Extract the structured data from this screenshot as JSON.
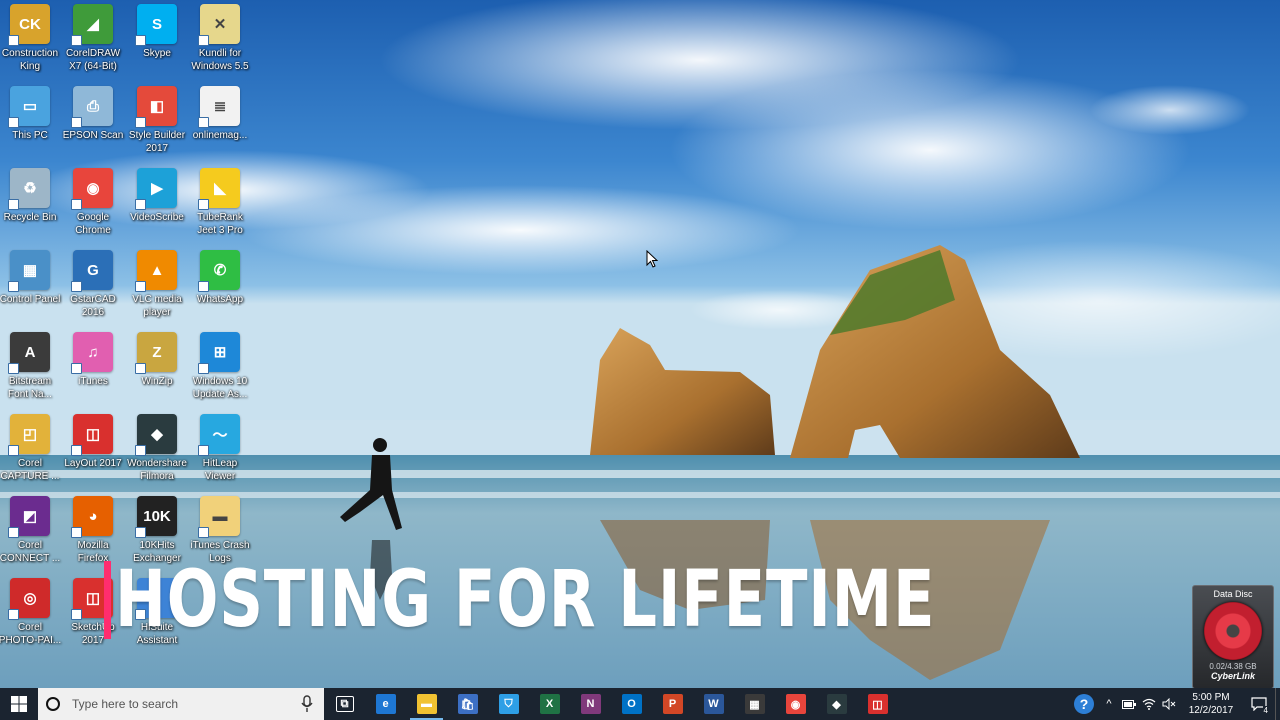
{
  "desktop": {
    "icons": [
      {
        "label": "Construction\nKing",
        "icon": "folder-person-icon",
        "color": "#d8a32c",
        "glyph": "CK"
      },
      {
        "label": "CorelDRAW\nX7 (64-Bit)",
        "icon": "coreldraw-icon",
        "color": "#3f9b3a",
        "glyph": "◢"
      },
      {
        "label": "Skype",
        "icon": "skype-icon",
        "color": "#00aff0",
        "glyph": "S"
      },
      {
        "label": "Kundli for\nWindows 5.5",
        "icon": "kundli-icon",
        "color": "#e6d78c",
        "glyph": "✕"
      },
      {
        "label": "This PC",
        "icon": "this-pc-icon",
        "color": "#4aa3df",
        "glyph": "▭"
      },
      {
        "label": "EPSON Scan",
        "icon": "epson-scan-icon",
        "color": "#8fb8d8",
        "glyph": "⎙"
      },
      {
        "label": "Style Builder\n2017",
        "icon": "style-builder-icon",
        "color": "#e44a3b",
        "glyph": "◧"
      },
      {
        "label": "onlinemag...",
        "icon": "document-icon",
        "color": "#f2f2f2",
        "glyph": "≣"
      },
      {
        "label": "Recycle Bin",
        "icon": "recycle-bin-icon",
        "color": "#9db6c8",
        "glyph": "♻"
      },
      {
        "label": "Google\nChrome",
        "icon": "chrome-icon",
        "color": "#e8453c",
        "glyph": "◉"
      },
      {
        "label": "VideoScribe",
        "icon": "videoscribe-icon",
        "color": "#1da1d8",
        "glyph": "▶"
      },
      {
        "label": "TubeRank\nJeet 3 Pro",
        "icon": "tuberank-icon",
        "color": "#f5cb1e",
        "glyph": "◣"
      },
      {
        "label": "Control Panel",
        "icon": "control-panel-icon",
        "color": "#4a90c8",
        "glyph": "▦"
      },
      {
        "label": "GstarCAD\n2016",
        "icon": "gstarcad-icon",
        "color": "#2b6fb7",
        "glyph": "G"
      },
      {
        "label": "VLC media\nplayer",
        "icon": "vlc-icon",
        "color": "#f08a00",
        "glyph": "▲"
      },
      {
        "label": "WhatsApp",
        "icon": "whatsapp-icon",
        "color": "#2fbe44",
        "glyph": "✆"
      },
      {
        "label": "Bitstream\nFont Na...",
        "icon": "bitstream-icon",
        "color": "#3b3b3b",
        "glyph": "A"
      },
      {
        "label": "iTunes",
        "icon": "itunes-icon",
        "color": "#e15fb0",
        "glyph": "♫"
      },
      {
        "label": "WinZip",
        "icon": "winzip-icon",
        "color": "#c9a640",
        "glyph": "Z"
      },
      {
        "label": "Windows 10\nUpdate As...",
        "icon": "windows-update-icon",
        "color": "#1e88d8",
        "glyph": "⊞"
      },
      {
        "label": "Corel\nCAPTURE ...",
        "icon": "corel-capture-icon",
        "color": "#e2b23a",
        "glyph": "◰"
      },
      {
        "label": "LayOut 2017",
        "icon": "layout-icon",
        "color": "#d9302e",
        "glyph": "◫"
      },
      {
        "label": "Wondershare\nFilmora",
        "icon": "filmora-icon",
        "color": "#2a3b3f",
        "glyph": "◆"
      },
      {
        "label": "HitLeap\nViewer",
        "icon": "hitleap-icon",
        "color": "#27a8e0",
        "glyph": "〜"
      },
      {
        "label": "Corel\nCONNECT ...",
        "icon": "corel-connect-icon",
        "color": "#6b2c8f",
        "glyph": "◩"
      },
      {
        "label": "Mozilla\nFirefox",
        "icon": "firefox-icon",
        "color": "#e66000",
        "glyph": "◕"
      },
      {
        "label": "10KHits\nExchanger",
        "icon": "10khits-icon",
        "color": "#222222",
        "glyph": "10K"
      },
      {
        "label": "iTunes Crash\nLogs",
        "icon": "folder-icon",
        "color": "#f1d17a",
        "glyph": "▬"
      },
      {
        "label": "Corel\nPHOTO-PAI...",
        "icon": "corel-photopaint-icon",
        "color": "#cf2a2a",
        "glyph": "◎"
      },
      {
        "label": "SketchUp\n2017",
        "icon": "sketchup-icon",
        "color": "#d9302e",
        "glyph": "◫"
      },
      {
        "label": "HiSuite\nAssistant",
        "icon": "hisuite-icon",
        "color": "#3d83d6",
        "glyph": "◐"
      }
    ]
  },
  "overlay": {
    "caption": "HOSTING FOR LIFETIME"
  },
  "widget": {
    "title": "Data Disc",
    "size": "0.02/4.38 GB",
    "brand": "CyberLink"
  },
  "taskbar": {
    "search_placeholder": "Type here to search",
    "apps": [
      {
        "name": "task-view-icon",
        "glyph": "⧉",
        "color": "transparent",
        "active": false
      },
      {
        "name": "edge-icon",
        "glyph": "e",
        "color": "#1e77d3",
        "active": false
      },
      {
        "name": "file-explorer-icon",
        "glyph": "▬",
        "color": "#f1c232",
        "active": true
      },
      {
        "name": "store-icon",
        "glyph": "🛍",
        "color": "#3c6fc4",
        "active": false
      },
      {
        "name": "security-icon",
        "glyph": "⛉",
        "color": "#2e9fe6",
        "active": false
      },
      {
        "name": "excel-icon",
        "glyph": "X",
        "color": "#1f7244",
        "active": false
      },
      {
        "name": "onenote-icon",
        "glyph": "N",
        "color": "#80397b",
        "active": false
      },
      {
        "name": "outlook-icon",
        "glyph": "O",
        "color": "#0072c6",
        "active": false
      },
      {
        "name": "powerpoint-icon",
        "glyph": "P",
        "color": "#d24726",
        "active": false
      },
      {
        "name": "word-icon",
        "glyph": "W",
        "color": "#2b579a",
        "active": false
      },
      {
        "name": "calculator-icon",
        "glyph": "▦",
        "color": "#3a3a3a",
        "active": false
      },
      {
        "name": "chrome-icon",
        "glyph": "◉",
        "color": "#e8453c",
        "active": false
      },
      {
        "name": "filmora-icon",
        "glyph": "◆",
        "color": "#2a3b3f",
        "active": false
      },
      {
        "name": "sketchup-icon",
        "glyph": "◫",
        "color": "#d9302e",
        "active": false
      }
    ],
    "tray": {
      "help_glyph": "?",
      "chevron_glyph": "^",
      "clock_time": "5:00 PM",
      "clock_date": "12/2/2017",
      "notification_count": "4"
    }
  },
  "colors": {
    "taskbar_bg": "#1b2430",
    "caption_accent": "#ff2d6f",
    "active_indicator": "#76b9ed"
  }
}
